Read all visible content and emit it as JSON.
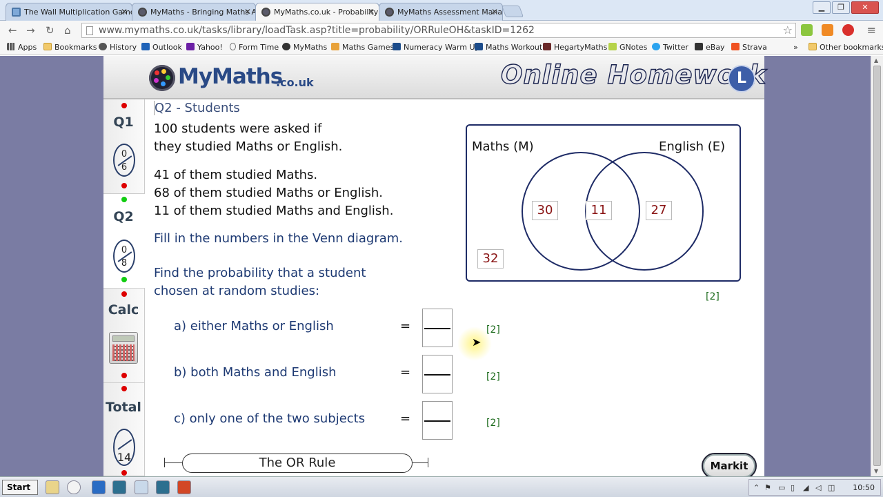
{
  "browser": {
    "tabs": [
      {
        "title": "The Wall Multiplication Game",
        "active": false
      },
      {
        "title": "MyMaths - Bringing Maths Al",
        "active": false
      },
      {
        "title": "MyMaths.co.uk - Probability",
        "active": true
      },
      {
        "title": "MyMaths Assessment Manag",
        "active": false
      }
    ],
    "url": "www.mymaths.co.uk/tasks/library/loadTask.asp?title=probability/ORRuleOH&taskID=1262",
    "bookmarks": [
      "Apps",
      "Bookmarks",
      "History",
      "Outlook",
      "Yahoo!",
      "Form Time",
      "MyMaths",
      "Maths Games",
      "Numeracy Warm Up",
      "Maths Workout",
      "HegartyMaths",
      "GNotes",
      "Twitter",
      "eBay",
      "Strava"
    ],
    "overflow_label": "»",
    "other_bookmarks": "Other bookmarks"
  },
  "header": {
    "logo_main": "MyMaths",
    "logo_suffix": ".co.uk",
    "title": "Online Homework",
    "title_icon": "L"
  },
  "sidebar": {
    "q1": {
      "label": "Q1",
      "score": "0",
      "max": "6"
    },
    "q2": {
      "label": "Q2",
      "score": "0",
      "max": "8"
    },
    "calc": {
      "label": "Calc"
    },
    "total": {
      "label": "Total",
      "max": "14"
    }
  },
  "question": {
    "title": "Q2 - Students",
    "intro_1": "100 students were asked if",
    "intro_2": "they studied Maths or English.",
    "fact_1": "41 of them studied Maths.",
    "fact_2": "68 of them studied Maths or English.",
    "fact_3": "11 of them studied Maths and English.",
    "instruction": "Fill in the numbers in the Venn diagram.",
    "prob_1": "Find the probability that a student",
    "prob_2": "chosen at random studies:",
    "venn": {
      "label_left": "Maths (M)",
      "label_right": "English (E)",
      "only_m": "30",
      "both": "11",
      "only_e": "27",
      "outside": "32",
      "marks": "[2]"
    },
    "parts": [
      {
        "label": "a)  either Maths or English",
        "eq": "=",
        "marks": "[2]"
      },
      {
        "label": "b)  both Maths and English",
        "eq": "=",
        "marks": "[2]"
      },
      {
        "label": "c)  only one of the two subjects",
        "eq": "=",
        "marks": "[2]"
      }
    ]
  },
  "footer": {
    "topic": "The OR Rule",
    "markit": "Markit"
  },
  "taskbar": {
    "start": "Start",
    "time": "10:50"
  }
}
